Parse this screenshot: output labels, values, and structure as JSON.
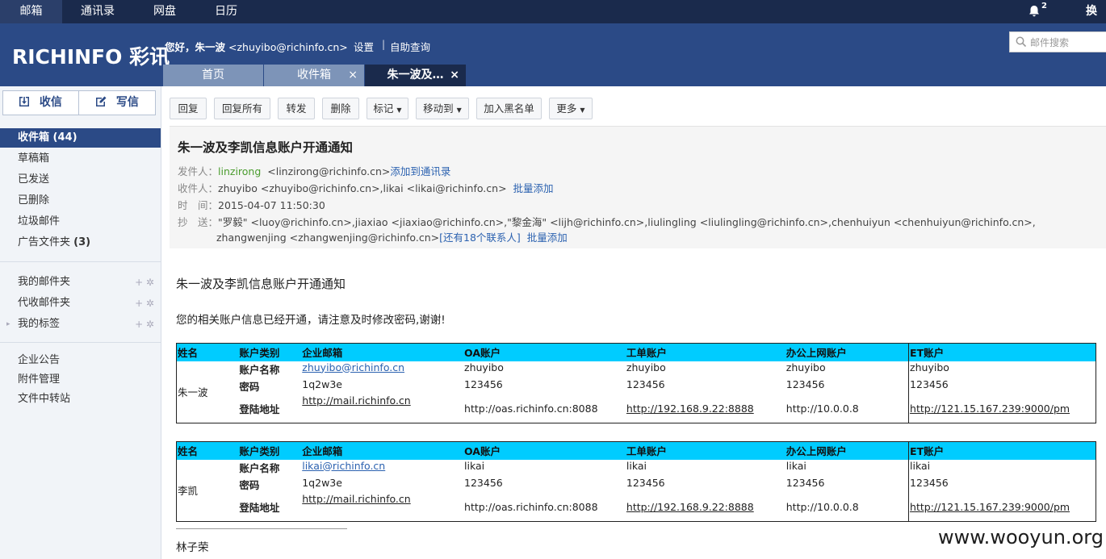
{
  "topnav": {
    "mail": "邮箱",
    "contacts": "通讯录",
    "disk": "网盘",
    "calendar": "日历",
    "bell_count": "2",
    "switch": "换肤"
  },
  "header": {
    "logo": "RICHINFO 彩讯",
    "greeting_prefix": "您好，",
    "greeting_name": "朱一波",
    "greeting_email": "<zhuyibo@richinfo.cn>",
    "settings": "设置",
    "sep": "|",
    "self_query": "自助查询",
    "search_placeholder": "邮件搜索"
  },
  "tabs": [
    {
      "label": "首页"
    },
    {
      "label": "收件箱",
      "close": "×"
    },
    {
      "label": "朱一波及…",
      "close": "×"
    }
  ],
  "sidebar": {
    "receive": "收信",
    "compose": "写信",
    "folders": [
      {
        "label": "收件箱",
        "count": "(44)"
      },
      {
        "label": "草稿箱"
      },
      {
        "label": "已发送"
      },
      {
        "label": "已删除"
      },
      {
        "label": "垃圾邮件"
      },
      {
        "label": "广告文件夹",
        "count": "(3)"
      }
    ],
    "groups": [
      {
        "label": "我的邮件夹"
      },
      {
        "label": "代收邮件夹"
      },
      {
        "label": "我的标签"
      }
    ],
    "tools": [
      "企业公告",
      "附件管理",
      "文件中转站"
    ]
  },
  "toolbar": {
    "reply": "回复",
    "reply_all": "回复所有",
    "forward": "转发",
    "delete": "删除",
    "mark": "标记",
    "move": "移动到",
    "blacklist": "加入黑名单",
    "more": "更多"
  },
  "mail": {
    "subject": "朱一波及李凯信息账户开通通知",
    "from_label": "发件人：",
    "from_name": "linzirong",
    "from_addr": "<linzirong@richinfo.cn>",
    "add_contact": "添加到通讯录",
    "to_label": "收件人：",
    "to_value": "zhuyibo <zhuyibo@richinfo.cn>,likai <likai@richinfo.cn>",
    "batch_add": "批量添加",
    "time_label": "时　间：",
    "time_value": "2015-04-07 11:50:30",
    "cc_label": "抄　送：",
    "cc_line1": "\"罗毅\" <luoy@richinfo.cn>,jiaxiao <jiaxiao@richinfo.cn>,\"黎金海\" <lijh@richinfo.cn>,liulingling <liulingling@richinfo.cn>,chenhuiyun <chenhuiyun@richinfo.cn>,",
    "cc_line2": "zhangwenjing <zhangwenjing@richinfo.cn>",
    "cc_more": "[还有18个联系人]",
    "cc_batch": "批量添加",
    "body_title": "朱一波及李凯信息账户开通通知",
    "body_msg": "您的相关账户信息已经开通，请注意及时修改密码,谢谢!",
    "table_headers": [
      "姓名",
      "账户类别",
      "企业邮箱",
      "OA账户",
      "工单账户",
      "办公上网账户",
      "ET账户"
    ],
    "row_labels": [
      "账户名称",
      "密码",
      "登陆地址"
    ],
    "accounts": [
      {
        "name": "朱一波",
        "mail_name": "zhuyibo@richinfo.cn",
        "mail_pwd": "1q2w3e",
        "mail_url": "http://mail.richinfo.cn",
        "oa_name": "zhuyibo",
        "oa_pwd": "123456",
        "oa_url": "http://oas.richinfo.cn:8088",
        "wo_name": "zhuyibo",
        "wo_pwd": "123456",
        "wo_url": "http://192.168.9.22:8888",
        "net_name": "zhuyibo",
        "net_pwd": "123456",
        "net_url": "http://10.0.0.8",
        "et_name": "zhuyibo",
        "et_pwd": "123456",
        "et_url": "http://121.15.167.239:9000/pm"
      },
      {
        "name": "李凯",
        "mail_name": "likai@richinfo.cn",
        "mail_pwd": "1q2w3e",
        "mail_url": "http://mail.richinfo.cn",
        "oa_name": "likai",
        "oa_pwd": "123456",
        "oa_url": "http://oas.richinfo.cn:8088",
        "wo_name": "likai",
        "wo_pwd": "123456",
        "wo_url": "http://192.168.9.22:8888",
        "net_name": "likai",
        "net_pwd": "123456",
        "net_url": "http://10.0.0.8",
        "et_name": "likai",
        "et_pwd": "123456",
        "et_url": "http://121.15.167.239:9000/pm"
      }
    ],
    "signature": "林子荣"
  },
  "watermark": "www.wooyun.org",
  "colors": {
    "header_bg": "#2b4a86",
    "topnav_bg": "#1a2a4c",
    "table_header": "#00ccff",
    "link": "#2c62b0"
  }
}
